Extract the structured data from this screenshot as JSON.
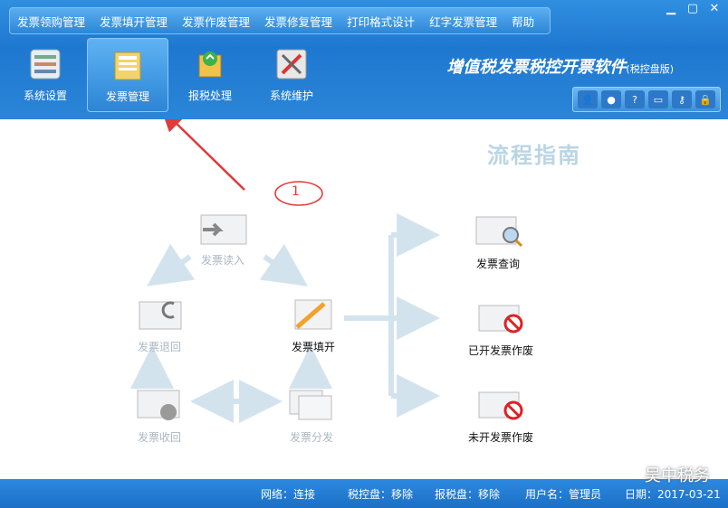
{
  "menu": [
    "发票领购管理",
    "发票填开管理",
    "发票作废管理",
    "发票修复管理",
    "打印格式设计",
    "红字发票管理",
    "帮助"
  ],
  "toolbar": [
    {
      "label": "系统设置",
      "icon": "settings-icon"
    },
    {
      "label": "发票管理",
      "icon": "invoice-folder-icon"
    },
    {
      "label": "报税处理",
      "icon": "tax-report-icon"
    },
    {
      "label": "系统维护",
      "icon": "maintenance-icon"
    }
  ],
  "app": {
    "name": "增值税发票税控开票软件",
    "edition": "(税控盘版)"
  },
  "guide": {
    "title": "流程指南",
    "annotation": "1"
  },
  "nodes": {
    "read": "发票读入",
    "fill": "发票填开",
    "return": "发票退回",
    "recover": "发票收回",
    "dist": "发票分发",
    "query": "发票查询",
    "void_issued": "已开发票作废",
    "void_unissued": "未开发票作废"
  },
  "status": {
    "network": "网络：连接",
    "taxdisk": "税控盘：移除",
    "reportdisk": "报税盘：移除",
    "user": "用户名：管理员",
    "date": "日期：2017-03-21"
  },
  "watermark": "吴中税务"
}
